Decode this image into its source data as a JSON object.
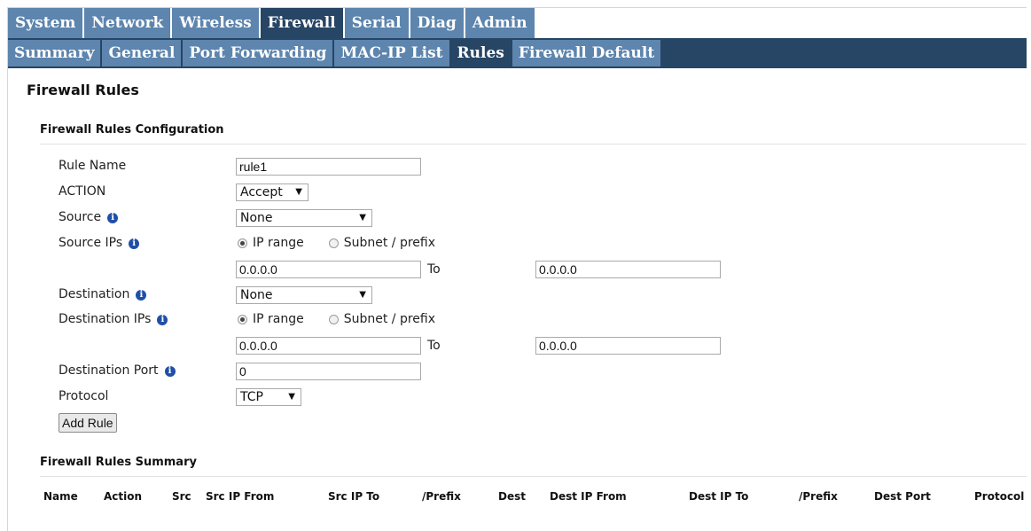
{
  "nav_primary": [
    "System",
    "Network",
    "Wireless",
    "Firewall",
    "Serial",
    "Diag",
    "Admin"
  ],
  "nav_secondary": [
    "Summary",
    "General",
    "Port Forwarding",
    "MAC-IP List",
    "Rules",
    "Firewall Default"
  ],
  "page_title": "Firewall Rules",
  "config": {
    "title": "Firewall Rules Configuration",
    "rule_name_label": "Rule Name",
    "rule_name_value": "rule1",
    "action_label": "ACTION",
    "action_value": "Accept",
    "source_label": "Source",
    "source_value": "None",
    "source_ips_label": "Source IPs",
    "ip_range_label": "IP range",
    "subnet_label": "Subnet / prefix",
    "source_ip_from": "0.0.0.0",
    "to_label": "To",
    "source_ip_to": "0.0.0.0",
    "destination_label": "Destination",
    "destination_value": "None",
    "destination_ips_label": "Destination IPs",
    "dest_ip_from": "0.0.0.0",
    "dest_ip_to": "0.0.0.0",
    "dest_port_label": "Destination Port",
    "dest_port_value": "0",
    "protocol_label": "Protocol",
    "protocol_value": "TCP",
    "add_rule_label": "Add Rule"
  },
  "summary": {
    "title": "Firewall Rules Summary",
    "columns": [
      "Name",
      "Action",
      "Src",
      "Src IP From",
      "Src IP To",
      "/Prefix",
      "Dest",
      "Dest IP From",
      "Dest IP To",
      "/Prefix",
      "Dest Port",
      "Protocol"
    ]
  },
  "colors": {
    "nav_tab": "#5d85ae",
    "nav_active": "#274564",
    "info_icon": "#1f4fa8"
  }
}
